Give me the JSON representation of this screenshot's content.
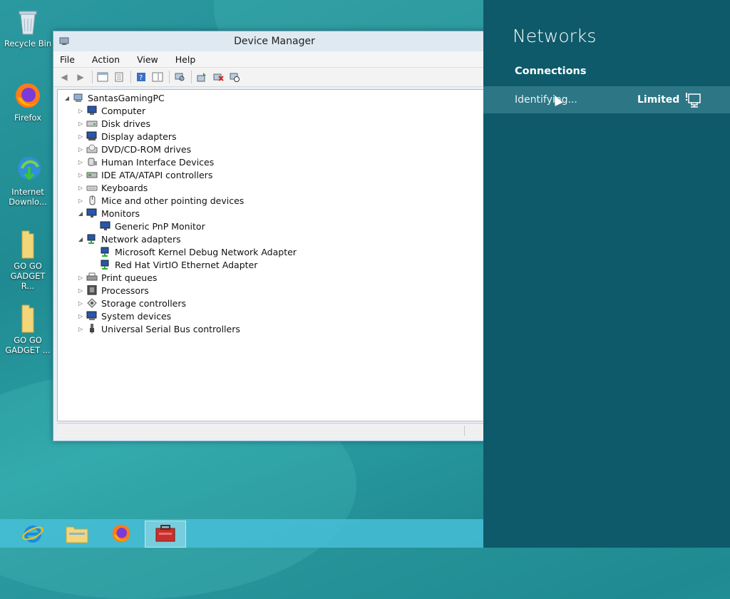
{
  "desktop": {
    "icons": [
      {
        "label": "Recycle Bin"
      },
      {
        "label": "Firefox"
      },
      {
        "label": "Internet Downlo..."
      },
      {
        "label": "GO GO GADGET R..."
      },
      {
        "label": "GO GO GADGET ..."
      }
    ]
  },
  "window": {
    "title": "Device Manager",
    "menu": [
      "File",
      "Action",
      "View",
      "Help"
    ],
    "tree": {
      "root": "SantasGamingPC",
      "items": [
        "Computer",
        "Disk drives",
        "Display adapters",
        "DVD/CD-ROM drives",
        "Human Interface Devices",
        "IDE ATA/ATAPI controllers",
        "Keyboards",
        "Mice and other pointing devices",
        "Monitors",
        "Generic PnP Monitor",
        "Network adapters",
        "Microsoft Kernel Debug Network Adapter",
        "Red Hat VirtIO Ethernet Adapter",
        "Print queues",
        "Processors",
        "Storage controllers",
        "System devices",
        "Universal Serial Bus controllers"
      ]
    }
  },
  "networks": {
    "title": "Networks",
    "section": "Connections",
    "connection": {
      "name": "Identifying...",
      "status": "Limited"
    }
  },
  "colors": {
    "pane": "#0e5a6a",
    "row_highlight": "#2c7685",
    "taskbar": "#46bed7"
  }
}
